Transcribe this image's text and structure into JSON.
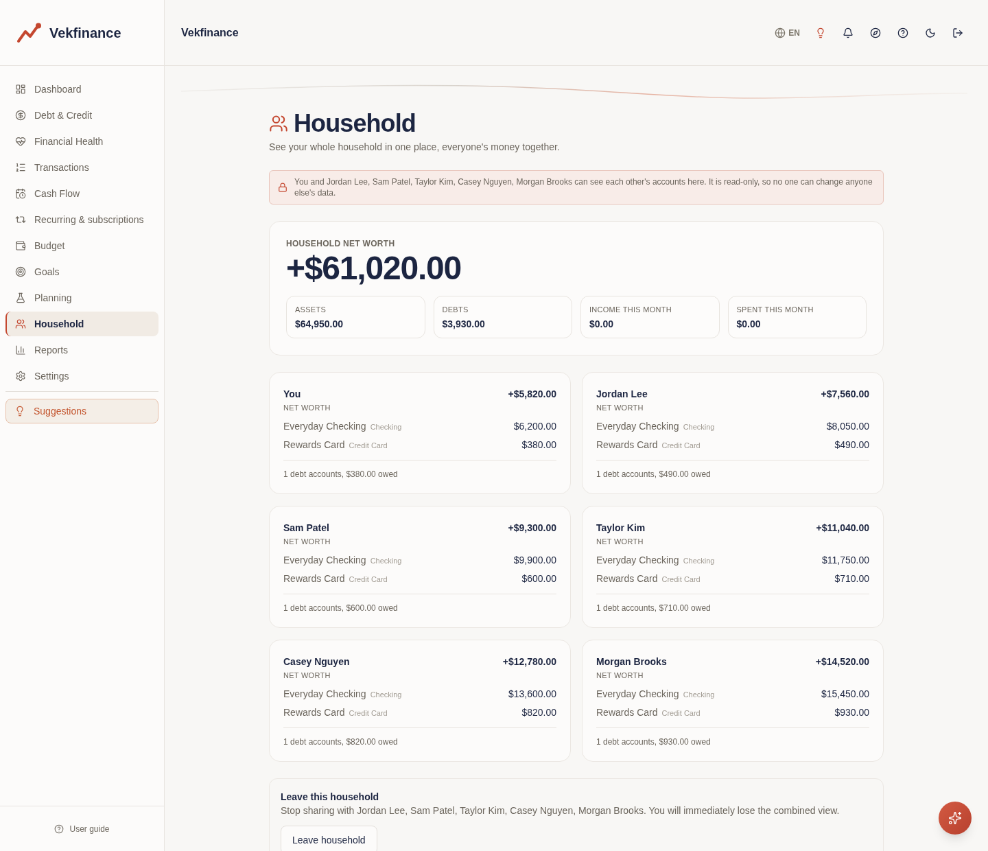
{
  "brand": {
    "name": "Vekfinance"
  },
  "sidebar": {
    "items": [
      {
        "label": "Dashboard",
        "selected": false
      },
      {
        "label": "Debt & Credit",
        "selected": false
      },
      {
        "label": "Financial Health",
        "selected": false
      },
      {
        "label": "Transactions",
        "selected": false
      },
      {
        "label": "Cash Flow",
        "selected": false
      },
      {
        "label": "Recurring & subscriptions",
        "selected": false
      },
      {
        "label": "Budget",
        "selected": false
      },
      {
        "label": "Goals",
        "selected": false
      },
      {
        "label": "Planning",
        "selected": false
      },
      {
        "label": "Household",
        "selected": true
      },
      {
        "label": "Reports",
        "selected": false
      },
      {
        "label": "Settings",
        "selected": false
      }
    ],
    "suggestions": {
      "label": "Suggestions"
    },
    "footer": {
      "label": "User guide"
    }
  },
  "header": {
    "title": "Vekfinance",
    "language": "EN"
  },
  "page": {
    "title": "Household",
    "subtitle": "See your whole household in one place, everyone's money together."
  },
  "notice": {
    "text": "You and Jordan Lee, Sam Patel, Taylor Kim, Casey Nguyen, Morgan Brooks can see each other's accounts here. It is read-only, so no one can change anyone else's data."
  },
  "net_worth": {
    "label": "HOUSEHOLD NET WORTH",
    "value": "+$61,020.00",
    "stats": [
      {
        "label": "ASSETS",
        "value": "$64,950.00"
      },
      {
        "label": "DEBTS",
        "value": "$3,930.00"
      },
      {
        "label": "INCOME THIS MONTH",
        "value": "$0.00"
      },
      {
        "label": "SPENT THIS MONTH",
        "value": "$0.00"
      }
    ]
  },
  "members": [
    {
      "name": "You",
      "net_worth": "+$5,820.00",
      "net_worth_label": "NET WORTH",
      "accounts": [
        {
          "name": "Everyday Checking",
          "type": "Checking",
          "balance": "$6,200.00"
        },
        {
          "name": "Rewards Card",
          "type": "Credit Card",
          "balance": "$380.00"
        }
      ],
      "summary": "1 debt accounts, $380.00 owed"
    },
    {
      "name": "Jordan Lee",
      "net_worth": "+$7,560.00",
      "net_worth_label": "NET WORTH",
      "accounts": [
        {
          "name": "Everyday Checking",
          "type": "Checking",
          "balance": "$8,050.00"
        },
        {
          "name": "Rewards Card",
          "type": "Credit Card",
          "balance": "$490.00"
        }
      ],
      "summary": "1 debt accounts, $490.00 owed"
    },
    {
      "name": "Sam Patel",
      "net_worth": "+$9,300.00",
      "net_worth_label": "NET WORTH",
      "accounts": [
        {
          "name": "Everyday Checking",
          "type": "Checking",
          "balance": "$9,900.00"
        },
        {
          "name": "Rewards Card",
          "type": "Credit Card",
          "balance": "$600.00"
        }
      ],
      "summary": "1 debt accounts, $600.00 owed"
    },
    {
      "name": "Taylor Kim",
      "net_worth": "+$11,040.00",
      "net_worth_label": "NET WORTH",
      "accounts": [
        {
          "name": "Everyday Checking",
          "type": "Checking",
          "balance": "$11,750.00"
        },
        {
          "name": "Rewards Card",
          "type": "Credit Card",
          "balance": "$710.00"
        }
      ],
      "summary": "1 debt accounts, $710.00 owed"
    },
    {
      "name": "Casey Nguyen",
      "net_worth": "+$12,780.00",
      "net_worth_label": "NET WORTH",
      "accounts": [
        {
          "name": "Everyday Checking",
          "type": "Checking",
          "balance": "$13,600.00"
        },
        {
          "name": "Rewards Card",
          "type": "Credit Card",
          "balance": "$820.00"
        }
      ],
      "summary": "1 debt accounts, $820.00 owed"
    },
    {
      "name": "Morgan Brooks",
      "net_worth": "+$14,520.00",
      "net_worth_label": "NET WORTH",
      "accounts": [
        {
          "name": "Everyday Checking",
          "type": "Checking",
          "balance": "$15,450.00"
        },
        {
          "name": "Rewards Card",
          "type": "Credit Card",
          "balance": "$930.00"
        }
      ],
      "summary": "1 debt accounts, $930.00 owed"
    }
  ],
  "leave": {
    "title": "Leave this household",
    "text": "Stop sharing with Jordan Lee, Sam Patel, Taylor Kim, Casey Nguyen, Morgan Brooks. You will immediately lose the combined view.",
    "button": "Leave household"
  }
}
